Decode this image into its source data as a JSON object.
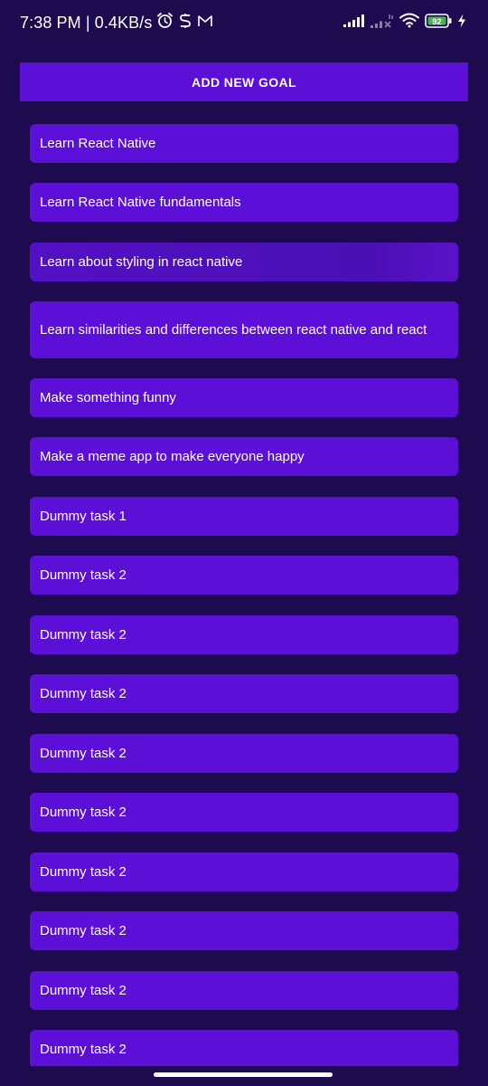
{
  "status_bar": {
    "time": "7:38 PM | 0.4KB/s",
    "icons": [
      "alarm-icon",
      "s-app-icon",
      "gmail-icon"
    ],
    "right_icons": [
      "signal-icon",
      "signal-no-service-icon",
      "wifi-icon",
      "battery-icon",
      "charging-icon"
    ],
    "battery_level": "92"
  },
  "header": {
    "add_goal_label": "ADD NEW GOAL"
  },
  "goals": [
    {
      "text": "Learn React Native"
    },
    {
      "text": "Learn React Native fundamentals"
    },
    {
      "text": "Learn about styling in react native"
    },
    {
      "text": "Learn similarities and differences between react native and react"
    },
    {
      "text": "Make something funny"
    },
    {
      "text": "Make a meme app to make everyone happy"
    },
    {
      "text": "Dummy task 1"
    },
    {
      "text": "Dummy task 2"
    },
    {
      "text": "Dummy task 2"
    },
    {
      "text": "Dummy task 2"
    },
    {
      "text": "Dummy task 2"
    },
    {
      "text": "Dummy task 2"
    },
    {
      "text": "Dummy task 2"
    },
    {
      "text": "Dummy task 2"
    },
    {
      "text": "Dummy task 2"
    },
    {
      "text": "Dummy task 2"
    }
  ],
  "colors": {
    "background": "#1e0a4f",
    "accent": "#5c0fd6",
    "text": "#ffffff"
  }
}
